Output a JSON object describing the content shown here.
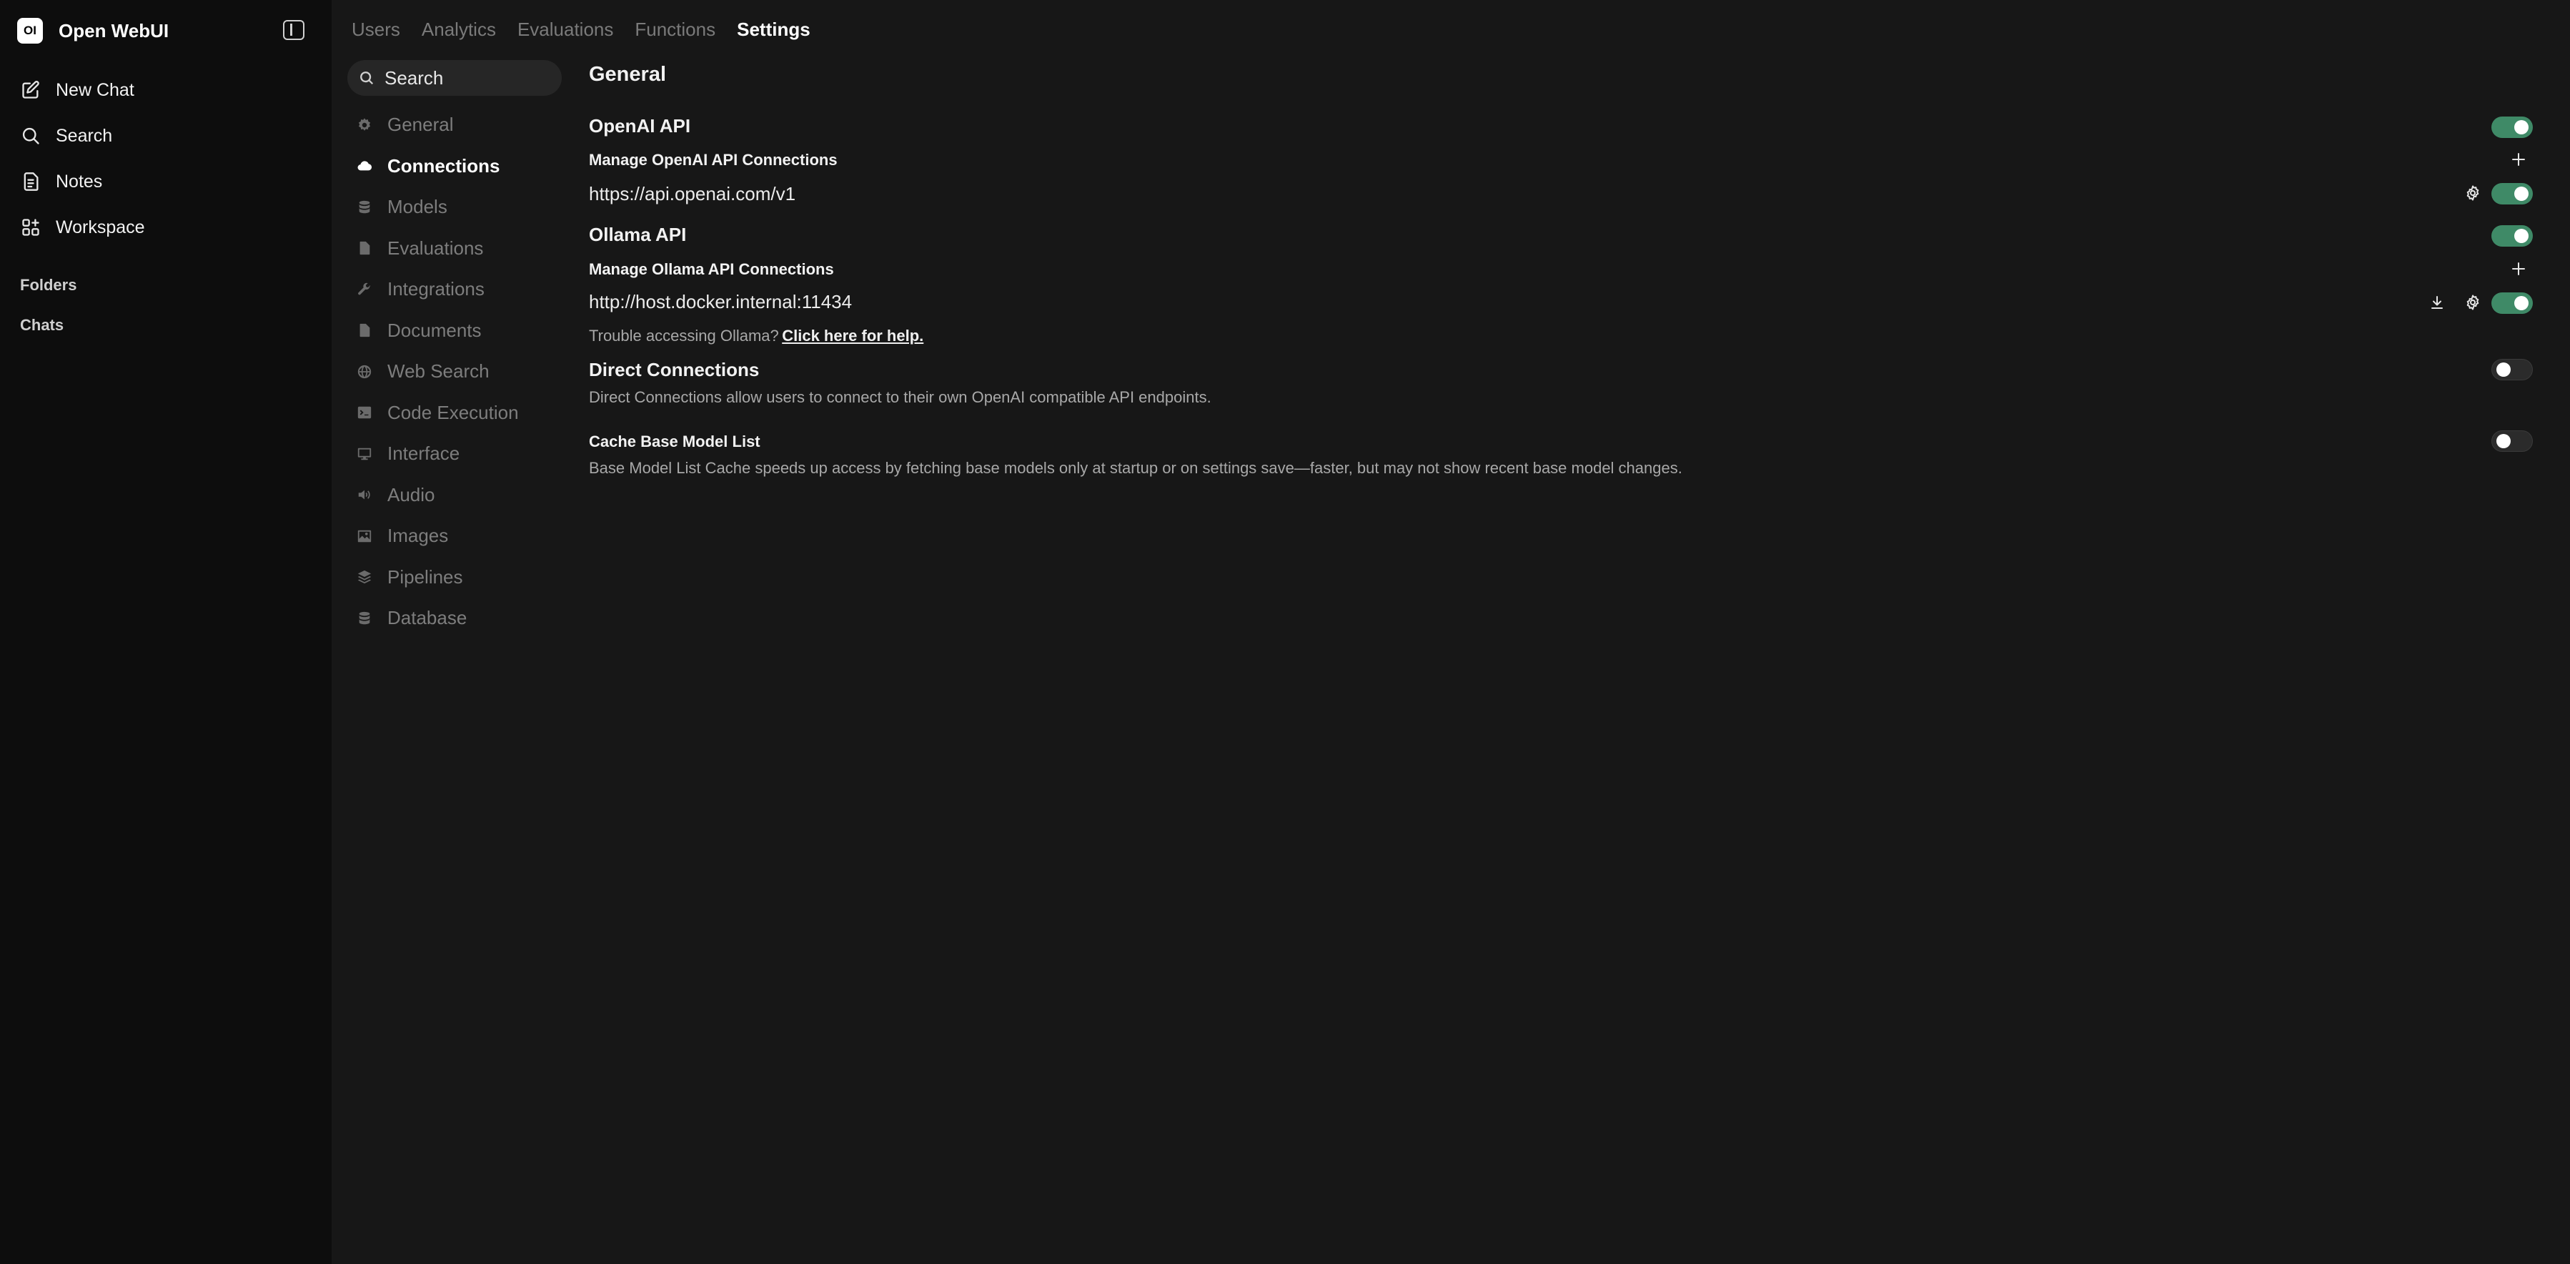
{
  "app": {
    "logo_text": "OI",
    "name": "Open WebUI"
  },
  "sidebar": {
    "nav": [
      {
        "label": "New Chat",
        "icon": "pencil-square-icon"
      },
      {
        "label": "Search",
        "icon": "search-icon"
      },
      {
        "label": "Notes",
        "icon": "document-icon"
      },
      {
        "label": "Workspace",
        "icon": "grid-icon"
      }
    ],
    "sections": {
      "folders": "Folders",
      "chats": "Chats"
    }
  },
  "top_tabs": [
    "Users",
    "Analytics",
    "Evaluations",
    "Functions",
    "Settings"
  ],
  "top_tab_active": "Settings",
  "settings_nav": {
    "search_placeholder": "Search",
    "active": "Connections",
    "items": [
      {
        "label": "General",
        "icon": "gear-icon"
      },
      {
        "label": "Connections",
        "icon": "cloud-icon"
      },
      {
        "label": "Models",
        "icon": "stack-icon"
      },
      {
        "label": "Evaluations",
        "icon": "document-icon"
      },
      {
        "label": "Integrations",
        "icon": "wrench-icon"
      },
      {
        "label": "Documents",
        "icon": "document-icon"
      },
      {
        "label": "Web Search",
        "icon": "globe-icon"
      },
      {
        "label": "Code Execution",
        "icon": "terminal-icon"
      },
      {
        "label": "Interface",
        "icon": "monitor-icon"
      },
      {
        "label": "Audio",
        "icon": "speaker-icon"
      },
      {
        "label": "Images",
        "icon": "image-icon"
      },
      {
        "label": "Pipelines",
        "icon": "layers-icon"
      },
      {
        "label": "Database",
        "icon": "database-icon"
      }
    ]
  },
  "content": {
    "title": "General",
    "openai": {
      "heading": "OpenAI API",
      "enabled": true,
      "manage_label": "Manage OpenAI API Connections",
      "connection_url": "https://api.openai.com/v1",
      "connection_enabled": true
    },
    "ollama": {
      "heading": "Ollama API",
      "enabled": true,
      "manage_label": "Manage Ollama API Connections",
      "connection_url": "http://host.docker.internal:11434",
      "connection_enabled": true,
      "trouble_text": "Trouble accessing Ollama?",
      "help_link": "Click here for help."
    },
    "direct": {
      "heading": "Direct Connections",
      "enabled": false,
      "description": "Direct Connections allow users to connect to their own OpenAI compatible API endpoints."
    },
    "cache": {
      "heading": "Cache Base Model List",
      "enabled": false,
      "description": "Base Model List Cache speeds up access by fetching base models only at startup or on settings save—faster, but may not show recent base model changes."
    }
  },
  "colors": {
    "toggle_on": "#3f8a67",
    "background": "#171717",
    "sidebar": "#0d0d0d"
  }
}
